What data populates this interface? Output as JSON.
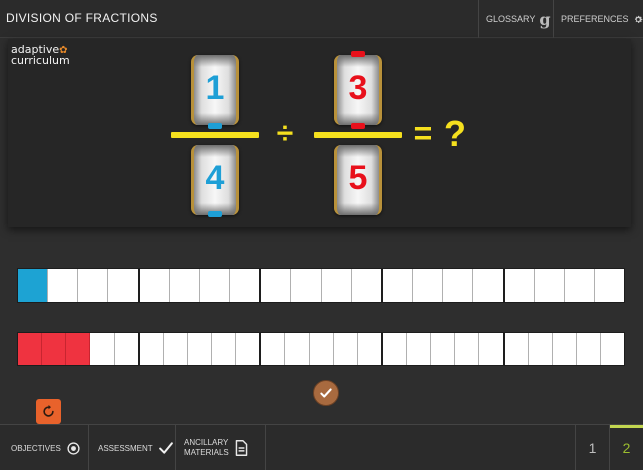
{
  "header": {
    "title": "DIVISION OF FRACTIONS",
    "glossary_label": "GLOSSARY",
    "glossary_icon": "g-glyph-icon",
    "preferences_label": "PREFERENCES",
    "preferences_icon": "gear-icon"
  },
  "stage": {
    "logo_line1": "adaptive",
    "logo_line2": "curriculum",
    "left_fraction": {
      "numerator": "1",
      "denominator": "4",
      "color": "#1e9fd6"
    },
    "right_fraction": {
      "numerator": "3",
      "denominator": "5",
      "color": "#e8101b"
    },
    "divide_symbol": "÷",
    "equals_symbol": "=",
    "result_symbol": "?",
    "accent_color": "#f5e01e"
  },
  "bars": {
    "top": {
      "groups": 5,
      "cells_per_group": 4,
      "filled": 1,
      "fill_color": "#1da3d3"
    },
    "bottom": {
      "groups": 5,
      "cells_per_group": 5,
      "filled": 3,
      "fill_color": "#ef3340"
    }
  },
  "controls": {
    "check_icon": "checkmark-icon",
    "check_color": "#a86a3f",
    "reset_icon": "reset-icon",
    "reset_color": "#e8622b"
  },
  "footer": {
    "objectives_label": "OBJECTIVES",
    "assessment_label": "ASSESSMENT",
    "ancillary_line1": "ANCILLARY",
    "ancillary_line2": "MATERIALS",
    "pages": [
      "1",
      "2"
    ],
    "active_page": "2"
  }
}
